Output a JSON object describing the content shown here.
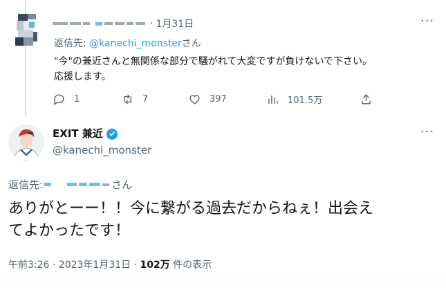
{
  "reply": {
    "date": "1月31日",
    "reply_prefix": "返信先: ",
    "reply_handle": "@kanechi_monster",
    "reply_suffix": "さん",
    "text_line1": "\"今\"の兼近さんと無関係な部分で騒がれて大変ですが負けないで下さい。",
    "text_line2": "応援します。",
    "stats": {
      "replies": "1",
      "retweets": "7",
      "likes": "397",
      "views": "101.5万"
    }
  },
  "tweet": {
    "author_name": "EXIT 兼近",
    "author_handle": "@kanechi_monster",
    "reply_prefix": "返信先:",
    "reply_suffix": "さん",
    "text_line1": "ありがとーー！！今に繋がる過去だからねぇ！出会え",
    "text_line2": "てよかったです！",
    "timestamp": "午前3:26 · 2023年1月31日",
    "sep": " · ",
    "views_count": "102万",
    "views_label": " 件の表示"
  },
  "icons": [
    "reply-icon",
    "retweet-icon",
    "like-icon",
    "views-icon",
    "share-icon",
    "more-icon",
    "verified-icon"
  ],
  "colors": {
    "link": "#1d9bf0",
    "muted": "#536471",
    "text": "#0f1419",
    "verified": "#1d9bf0"
  }
}
